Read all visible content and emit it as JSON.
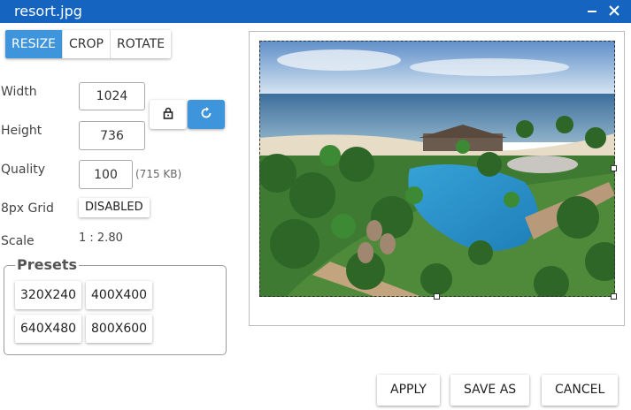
{
  "window": {
    "title": "resort.jpg",
    "minimize_icon": "minimize-icon",
    "close_icon": "close-icon"
  },
  "tabs": [
    {
      "label": "RESIZE",
      "active": true
    },
    {
      "label": "CROP",
      "active": false
    },
    {
      "label": "ROTATE",
      "active": false
    }
  ],
  "resize": {
    "width_label": "Width",
    "width_value": "1024",
    "height_label": "Height",
    "height_value": "736",
    "quality_label": "Quality",
    "quality_value": "100",
    "file_size": "(715 KB)",
    "grid_label": "8px Grid",
    "grid_button": "DISABLED",
    "scale_label": "Scale",
    "scale_value": "1 : 2.80",
    "lock_icon": "lock-icon",
    "reset_icon": "reset-icon"
  },
  "presets": {
    "legend": "Presets",
    "items": [
      "320X240",
      "400X400",
      "640X480",
      "800X600"
    ]
  },
  "preview": {
    "image": "resort-aerial-photo"
  },
  "footer": {
    "apply": "APPLY",
    "save_as": "SAVE AS",
    "cancel": "CANCEL"
  },
  "colors": {
    "titlebar": "#1565c0",
    "accent": "#3e95dc"
  }
}
